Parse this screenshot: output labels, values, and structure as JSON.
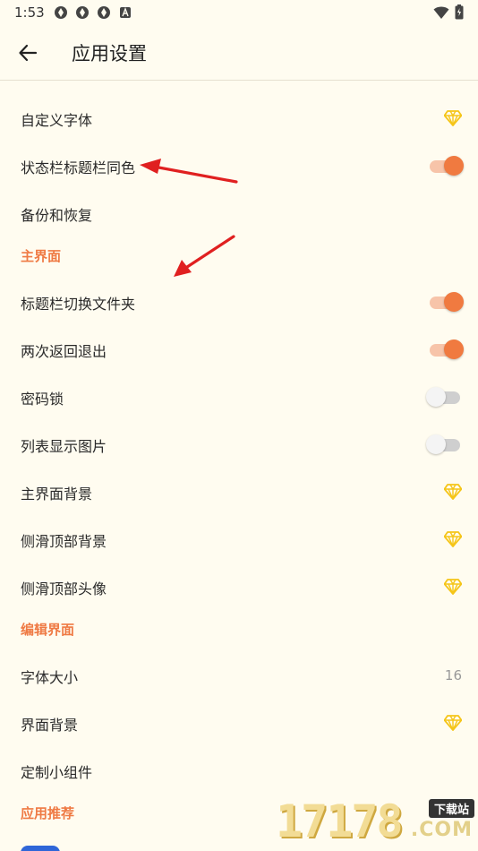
{
  "status_bar": {
    "time": "1:53"
  },
  "app_bar": {
    "title": "应用设置"
  },
  "rows": [
    {
      "type": "item",
      "label": "自定义字体",
      "trailing": "gem"
    },
    {
      "type": "item",
      "label": "状态栏标题栏同色",
      "trailing": "switch",
      "on": true
    },
    {
      "type": "item",
      "label": "备份和恢复",
      "trailing": "none"
    },
    {
      "type": "section",
      "label": "主界面"
    },
    {
      "type": "item",
      "label": "标题栏切换文件夹",
      "trailing": "switch",
      "on": true
    },
    {
      "type": "item",
      "label": "两次返回退出",
      "trailing": "switch",
      "on": true
    },
    {
      "type": "item",
      "label": "密码锁",
      "trailing": "switch",
      "on": false
    },
    {
      "type": "item",
      "label": "列表显示图片",
      "trailing": "switch",
      "on": false
    },
    {
      "type": "item",
      "label": "主界面背景",
      "trailing": "gem"
    },
    {
      "type": "item",
      "label": "侧滑顶部背景",
      "trailing": "gem"
    },
    {
      "type": "item",
      "label": "侧滑顶部头像",
      "trailing": "gem"
    },
    {
      "type": "section",
      "label": "编辑界面"
    },
    {
      "type": "item",
      "label": "字体大小",
      "trailing": "value",
      "value": "16"
    },
    {
      "type": "item",
      "label": "界面背景",
      "trailing": "gem"
    },
    {
      "type": "item",
      "label": "定制小组件",
      "trailing": "none"
    },
    {
      "type": "section",
      "label": "应用推荐"
    }
  ],
  "watermark": {
    "number": "17178",
    "site": "下载站",
    "domain": ".COM"
  },
  "colors": {
    "background": "#fffcf0",
    "accent": "#f07a40",
    "gem": "#f5c518",
    "arrow": "#e02020"
  }
}
